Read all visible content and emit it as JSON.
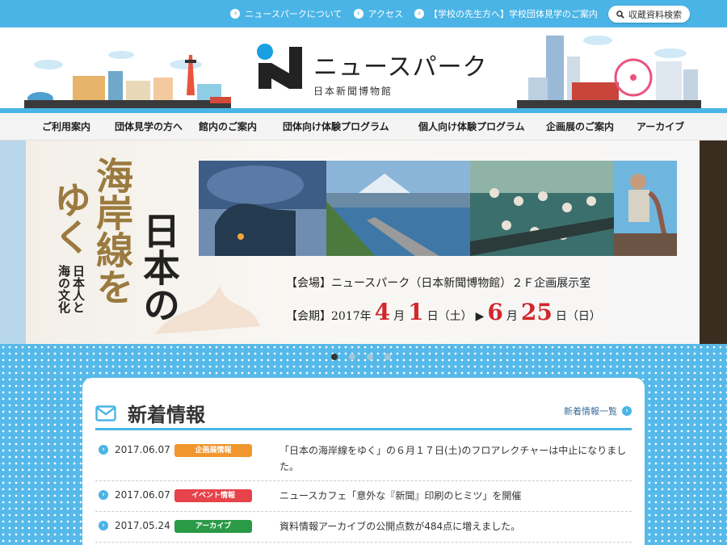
{
  "topbar": {
    "links": [
      "ニュースパークについて",
      "アクセス",
      "【学校の先生方へ】学校団体見学のご案内"
    ],
    "search_label": "収蔵資料検索"
  },
  "logo": {
    "title": "ニュースパーク",
    "subtitle": "日本新聞博物館"
  },
  "nav": [
    "ご利用案内",
    "団体見学の方へ",
    "館内のご案内",
    "団体向け体験プログラム",
    "個人向け体験プログラム",
    "企画展のご案内",
    "アーカイブ"
  ],
  "hero": {
    "title_main": "日本の海岸線をゆく",
    "title_col1": "海岸線を",
    "title_col2": "ゆく",
    "title_col3": "日本の",
    "subtitle_col1": "日本人と",
    "subtitle_col2": "海の文化",
    "venue": "【会場】ニュースパーク（日本新聞博物館）２Ｆ企画展示室",
    "period_label": "【会期】2017年",
    "start_month": "4",
    "month_suffix": "月",
    "start_day": "1",
    "start_dow": "日（土）",
    "arrow": "▶",
    "end_month": "6",
    "end_day": "25",
    "end_dow": "日（日）",
    "slides": 4,
    "active_slide": 1
  },
  "news": {
    "title": "新着情報",
    "more_label": "新着情報一覧",
    "items": [
      {
        "date": "2017.06.07",
        "badge": "企画展情報",
        "badge_color": "#f0962d",
        "text": "「日本の海岸線をゆく」の６月１７日(土)のフロアレクチャーは中止になりました。"
      },
      {
        "date": "2017.06.07",
        "badge": "イベント情報",
        "badge_color": "#e6434b",
        "text": "ニュースカフェ「意外な『新聞』印刷のヒミツ」を開催"
      },
      {
        "date": "2017.05.24",
        "badge": "アーカイブ",
        "badge_color": "#2a9a47",
        "text": "資料情報アーカイブの公開点数が484点に増えました。"
      }
    ]
  },
  "colors": {
    "accent": "#4ab4e6",
    "title_red": "#d1282d"
  }
}
